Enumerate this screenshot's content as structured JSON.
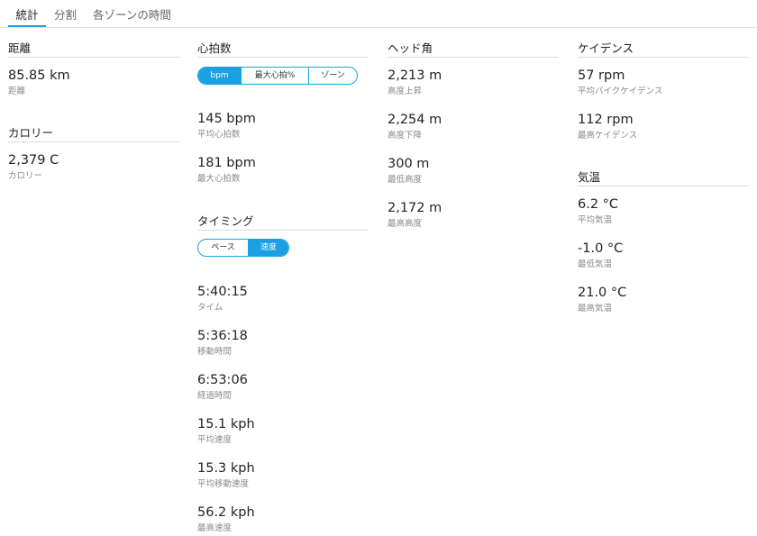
{
  "tabs": [
    "統計",
    "分割",
    "各ゾーンの時間"
  ],
  "colors": {
    "accent": "#1ba1e2"
  },
  "distance": {
    "title": "距離",
    "stats": [
      {
        "value": "85.85 km",
        "label": "距離"
      }
    ]
  },
  "calories": {
    "title": "カロリー",
    "stats": [
      {
        "value": "2,379 C",
        "label": "カロリー"
      }
    ]
  },
  "heart_rate": {
    "title": "心拍数",
    "toggle": [
      "bpm",
      "最大心拍%",
      "ゾーン"
    ],
    "selected": "bpm",
    "stats": [
      {
        "value": "145 bpm",
        "label": "平均心拍数"
      },
      {
        "value": "181 bpm",
        "label": "最大心拍数"
      }
    ]
  },
  "timing": {
    "title": "タイミング",
    "toggle": [
      "ペース",
      "速度"
    ],
    "selected": "速度",
    "stats": [
      {
        "value": "5:40:15",
        "label": "タイム"
      },
      {
        "value": "5:36:18",
        "label": "移動時間"
      },
      {
        "value": "6:53:06",
        "label": "経過時間"
      },
      {
        "value": "15.1 kph",
        "label": "平均速度"
      },
      {
        "value": "15.3 kph",
        "label": "平均移動速度"
      },
      {
        "value": "56.2 kph",
        "label": "最高速度"
      }
    ]
  },
  "elevation": {
    "title": "ヘッド角",
    "stats": [
      {
        "value": "2,213 m",
        "label": "高度上昇"
      },
      {
        "value": "2,254 m",
        "label": "高度下降"
      },
      {
        "value": "300 m",
        "label": "最低高度"
      },
      {
        "value": "2,172 m",
        "label": "最高高度"
      }
    ]
  },
  "cadence": {
    "title": "ケイデンス",
    "stats": [
      {
        "value": "57 rpm",
        "label": "平均バイクケイデンス"
      },
      {
        "value": "112 rpm",
        "label": "最高ケイデンス"
      }
    ]
  },
  "temperature": {
    "title": "気温",
    "stats": [
      {
        "value": "6.2 °C",
        "label": "平均気温"
      },
      {
        "value": "-1.0 °C",
        "label": "最低気温"
      },
      {
        "value": "21.0 °C",
        "label": "最高気温"
      }
    ]
  }
}
